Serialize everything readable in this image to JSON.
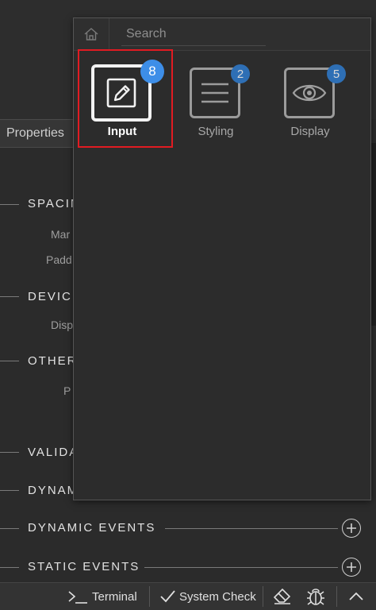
{
  "properties_tab": {
    "label": "Properties"
  },
  "sections": [
    {
      "title": "SPACIN",
      "items": [
        "Mar",
        "Padd"
      ]
    },
    {
      "title": "DEVIC",
      "items": [
        "Disp"
      ]
    },
    {
      "title": "OTHER",
      "items": [
        "P"
      ]
    },
    {
      "title": "VALIDA",
      "items": []
    },
    {
      "title": "DYNAM",
      "items": []
    },
    {
      "title": "DYNAMIC EVENTS",
      "items": []
    },
    {
      "title": "STATIC EVENTS",
      "items": []
    }
  ],
  "popup": {
    "search": {
      "placeholder": "Search",
      "value": ""
    },
    "home_icon": "home-icon",
    "categories": [
      {
        "label": "Input",
        "count": "8",
        "icon": "edit-icon",
        "selected": true
      },
      {
        "label": "Styling",
        "count": "2",
        "icon": "menu-lines-icon",
        "selected": false
      },
      {
        "label": "Display",
        "count": "5",
        "icon": "eye-icon",
        "selected": false
      }
    ]
  },
  "toolbar": {
    "terminal_label": "Terminal",
    "system_check_label": "System Check"
  },
  "colors": {
    "badge_active": "#3d8ee8",
    "badge_inactive": "#2e6fb5",
    "highlight": "#e11b22"
  }
}
